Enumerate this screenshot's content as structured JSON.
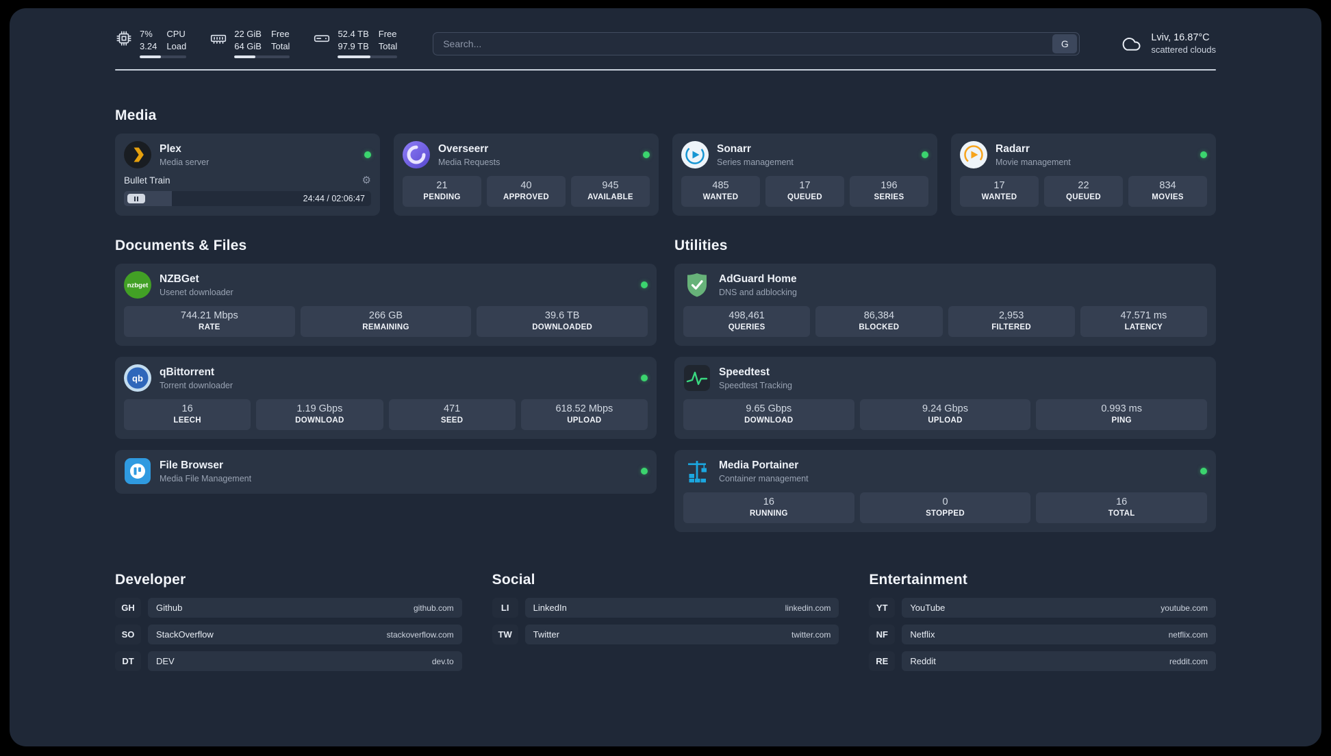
{
  "topbar": {
    "cpu": {
      "value_top": "7%",
      "value_bottom": "3.24",
      "label_top": "CPU",
      "label_bottom": "Load"
    },
    "ram": {
      "value_top": "22 GiB",
      "value_bottom": "64 GiB",
      "label_top": "Free",
      "label_bottom": "Total"
    },
    "disk": {
      "value_top": "52.4 TB",
      "value_bottom": "97.9 TB",
      "label_top": "Free",
      "label_bottom": "Total"
    },
    "search": {
      "placeholder": "Search...",
      "engine": "G"
    },
    "weather": {
      "location": "Lviv, 16.87°C",
      "condition": "scattered clouds"
    }
  },
  "sections": {
    "media": "Media",
    "documents": "Documents & Files",
    "utilities": "Utilities",
    "developer": "Developer",
    "social": "Social",
    "entertainment": "Entertainment"
  },
  "services": {
    "plex": {
      "name": "Plex",
      "subtitle": "Media server",
      "now_playing": "Bullet Train",
      "time": "24:44 / 02:06:47"
    },
    "overseerr": {
      "name": "Overseerr",
      "subtitle": "Media Requests",
      "stats": [
        {
          "value": "21",
          "label": "PENDING"
        },
        {
          "value": "40",
          "label": "APPROVED"
        },
        {
          "value": "945",
          "label": "AVAILABLE"
        }
      ]
    },
    "sonarr": {
      "name": "Sonarr",
      "subtitle": "Series management",
      "stats": [
        {
          "value": "485",
          "label": "WANTED"
        },
        {
          "value": "17",
          "label": "QUEUED"
        },
        {
          "value": "196",
          "label": "SERIES"
        }
      ]
    },
    "radarr": {
      "name": "Radarr",
      "subtitle": "Movie management",
      "stats": [
        {
          "value": "17",
          "label": "WANTED"
        },
        {
          "value": "22",
          "label": "QUEUED"
        },
        {
          "value": "834",
          "label": "MOVIES"
        }
      ]
    },
    "nzbget": {
      "name": "NZBGet",
      "subtitle": "Usenet downloader",
      "icon_text": "nzbget",
      "stats": [
        {
          "value": "744.21 Mbps",
          "label": "RATE"
        },
        {
          "value": "266 GB",
          "label": "REMAINING"
        },
        {
          "value": "39.6 TB",
          "label": "DOWNLOADED"
        }
      ]
    },
    "qbittorrent": {
      "name": "qBittorrent",
      "subtitle": "Torrent downloader",
      "icon_text": "qb",
      "stats": [
        {
          "value": "16",
          "label": "LEECH"
        },
        {
          "value": "1.19 Gbps",
          "label": "DOWNLOAD"
        },
        {
          "value": "471",
          "label": "SEED"
        },
        {
          "value": "618.52 Mbps",
          "label": "UPLOAD"
        }
      ]
    },
    "filebrowser": {
      "name": "File Browser",
      "subtitle": "Media File Management"
    },
    "adguard": {
      "name": "AdGuard Home",
      "subtitle": "DNS and adblocking",
      "stats": [
        {
          "value": "498,461",
          "label": "QUERIES"
        },
        {
          "value": "86,384",
          "label": "BLOCKED"
        },
        {
          "value": "2,953",
          "label": "FILTERED"
        },
        {
          "value": "47.571 ms",
          "label": "LATENCY"
        }
      ]
    },
    "speedtest": {
      "name": "Speedtest",
      "subtitle": "Speedtest Tracking",
      "stats": [
        {
          "value": "9.65 Gbps",
          "label": "DOWNLOAD"
        },
        {
          "value": "9.24 Gbps",
          "label": "UPLOAD"
        },
        {
          "value": "0.993 ms",
          "label": "PING"
        }
      ]
    },
    "portainer": {
      "name": "Media Portainer",
      "subtitle": "Container management",
      "stats": [
        {
          "value": "16",
          "label": "RUNNING"
        },
        {
          "value": "0",
          "label": "STOPPED"
        },
        {
          "value": "16",
          "label": "TOTAL"
        }
      ]
    }
  },
  "bookmarks": {
    "developer": [
      {
        "abbr": "GH",
        "name": "Github",
        "url": "github.com"
      },
      {
        "abbr": "SO",
        "name": "StackOverflow",
        "url": "stackoverflow.com"
      },
      {
        "abbr": "DT",
        "name": "DEV",
        "url": "dev.to"
      }
    ],
    "social": [
      {
        "abbr": "LI",
        "name": "LinkedIn",
        "url": "linkedin.com"
      },
      {
        "abbr": "TW",
        "name": "Twitter",
        "url": "twitter.com"
      }
    ],
    "entertainment": [
      {
        "abbr": "YT",
        "name": "YouTube",
        "url": "youtube.com"
      },
      {
        "abbr": "NF",
        "name": "Netflix",
        "url": "netflix.com"
      },
      {
        "abbr": "RE",
        "name": "Reddit",
        "url": "reddit.com"
      }
    ]
  }
}
